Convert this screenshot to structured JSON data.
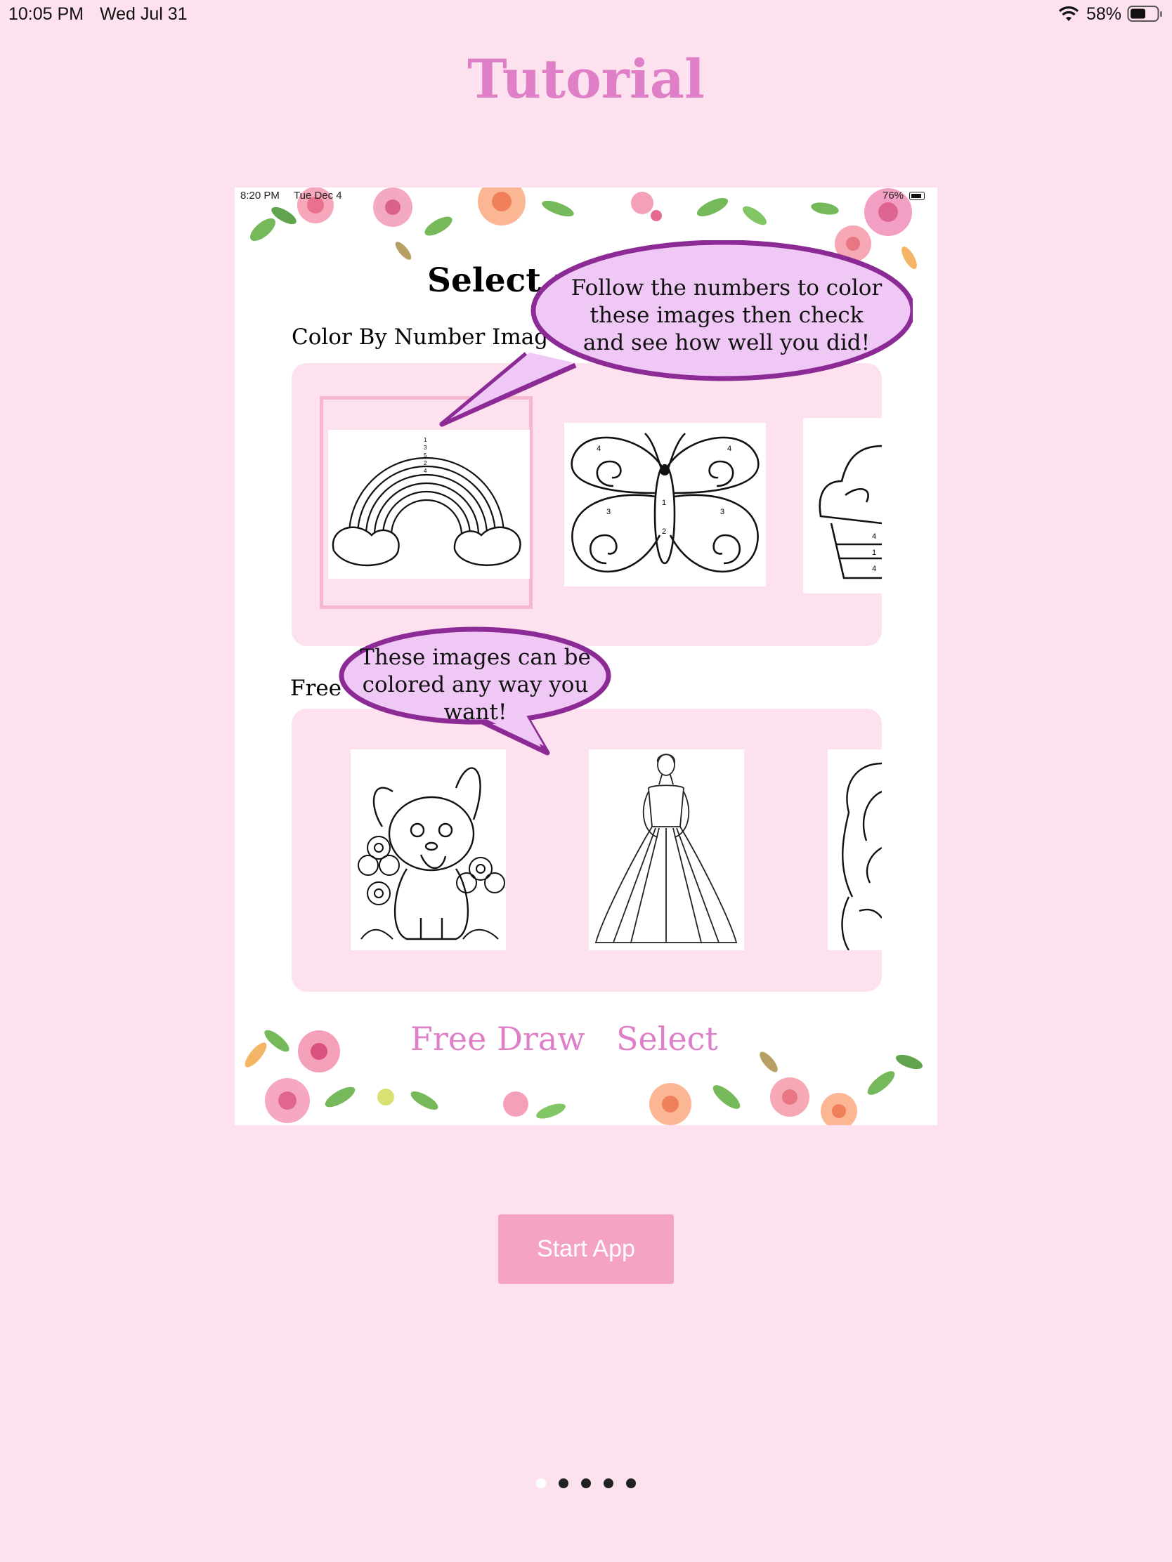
{
  "status_bar": {
    "time": "10:05 PM",
    "date": "Wed Jul 31",
    "battery_percent": "58%"
  },
  "page_title": "Tutorial",
  "screenshot": {
    "status_time": "8:20 PM",
    "status_date": "Tue Dec 4",
    "status_battery": "76%",
    "title": "Select a",
    "section1_label": "Color By Number Imag",
    "section2_label": "Free C",
    "bubble1_lines": [
      "Follow the numbers to color",
      "these images then check",
      "and see how well you did!"
    ],
    "bubble2_lines": [
      "These images can be",
      "colored any way you want!"
    ],
    "free_draw_label": "Free Draw",
    "select_label": "Select",
    "cbn_numbers": [
      "1",
      "3",
      "5",
      "2",
      "4",
      "4",
      "4",
      "1",
      "3",
      "3",
      "2",
      "4",
      "1",
      "4"
    ]
  },
  "start_button_label": "Start App",
  "pager": {
    "page_count": 5,
    "current_page": 1
  },
  "colors": {
    "background": "#fde1ee",
    "accent_pink": "#de7fc8",
    "bubble_fill": "#f0c8f5",
    "bubble_stroke": "#8c2a96",
    "button": "#f5a3c5"
  }
}
